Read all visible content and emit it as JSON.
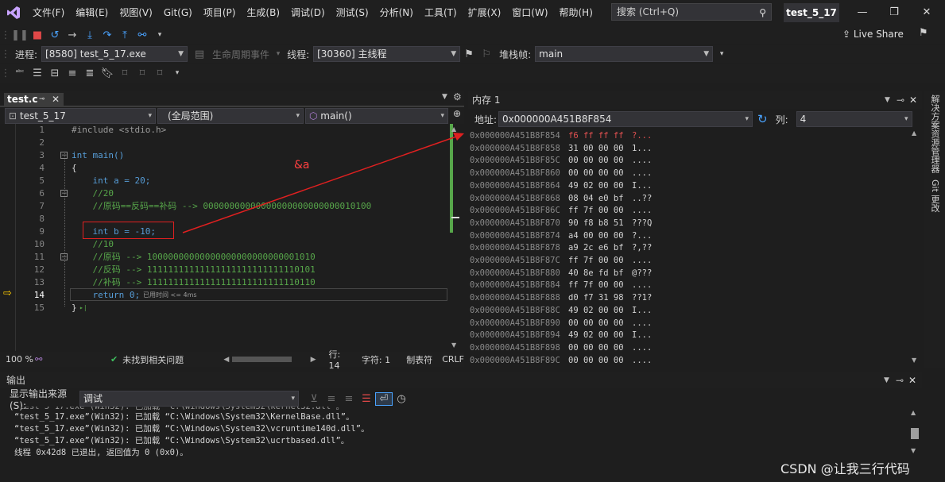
{
  "menu": [
    "文件(F)",
    "编辑(E)",
    "视图(V)",
    "Git(G)",
    "项目(P)",
    "生成(B)",
    "调试(D)",
    "测试(S)",
    "分析(N)",
    "工具(T)",
    "扩展(X)",
    "窗口(W)",
    "帮助(H)"
  ],
  "search": {
    "placeholder": "搜索 (Ctrl+Q)"
  },
  "window_title": "test_5_17",
  "live_share": "Live Share",
  "debug_bar": {
    "process_label": "进程:",
    "process_value": "[8580] test_5_17.exe",
    "lifecycle_label": "生命周期事件",
    "thread_label": "线程:",
    "thread_value": "[30360] 主线程",
    "stack_label": "堆栈帧:",
    "stack_value": "main"
  },
  "editor": {
    "tab_name": "test.c",
    "scope_project": "test_5_17",
    "scope_global": "(全局范围)",
    "scope_function": "main()",
    "lines": [
      {
        "n": "1",
        "t": "#include <stdio.h>"
      },
      {
        "n": "2",
        "t": ""
      },
      {
        "n": "3",
        "t": "int main()"
      },
      {
        "n": "4",
        "t": "{"
      },
      {
        "n": "5",
        "t": "    int a = 20;"
      },
      {
        "n": "6",
        "t": "    //20"
      },
      {
        "n": "7",
        "t": "    //原码==反码==补码 --> 00000000000000000000000000010100"
      },
      {
        "n": "8",
        "t": ""
      },
      {
        "n": "9",
        "t": "    int b = -10;"
      },
      {
        "n": "10",
        "t": "    //10"
      },
      {
        "n": "11",
        "t": "    //原码 --> 10000000000000000000000000001010"
      },
      {
        "n": "12",
        "t": "    //反码 --> 11111111111111111111111111110101"
      },
      {
        "n": "13",
        "t": "    //补码 --> 11111111111111111111111111110110"
      },
      {
        "n": "14",
        "t": "    return 0;"
      },
      {
        "n": "15",
        "t": "}"
      }
    ],
    "elapsed": "已用时间 <= 4ms",
    "annotation": "&a"
  },
  "editor_status": {
    "zoom": "100 %",
    "issues": "未找到相关问题",
    "line": "行: 14",
    "char": "字符: 1",
    "tabs": "制表符",
    "eol": "CRLF"
  },
  "memory": {
    "title": "内存 1",
    "addr_label": "地址:",
    "addr_value": "0x000000A451B8F854",
    "col_label": "列:",
    "col_value": "4",
    "rows": [
      {
        "a": "0x000000A451B8F854",
        "b": "f6 ff ff ff",
        "c": "?..."
      },
      {
        "a": "0x000000A451B8F858",
        "b": "31 00 00 00",
        "c": "1..."
      },
      {
        "a": "0x000000A451B8F85C",
        "b": "00 00 00 00",
        "c": "...."
      },
      {
        "a": "0x000000A451B8F860",
        "b": "00 00 00 00",
        "c": "...."
      },
      {
        "a": "0x000000A451B8F864",
        "b": "49 02 00 00",
        "c": "I..."
      },
      {
        "a": "0x000000A451B8F868",
        "b": "08 04 e0 bf",
        "c": "..??"
      },
      {
        "a": "0x000000A451B8F86C",
        "b": "ff 7f 00 00",
        "c": "...."
      },
      {
        "a": "0x000000A451B8F870",
        "b": "90 f8 b8 51",
        "c": "???Q"
      },
      {
        "a": "0x000000A451B8F874",
        "b": "a4 00 00 00",
        "c": "?..."
      },
      {
        "a": "0x000000A451B8F878",
        "b": "a9 2c e6 bf",
        "c": "?,??"
      },
      {
        "a": "0x000000A451B8F87C",
        "b": "ff 7f 00 00",
        "c": "...."
      },
      {
        "a": "0x000000A451B8F880",
        "b": "40 8e fd bf",
        "c": "@???"
      },
      {
        "a": "0x000000A451B8F884",
        "b": "ff 7f 00 00",
        "c": "...."
      },
      {
        "a": "0x000000A451B8F888",
        "b": "d0 f7 31 98",
        "c": "??1?"
      },
      {
        "a": "0x000000A451B8F88C",
        "b": "49 02 00 00",
        "c": "I..."
      },
      {
        "a": "0x000000A451B8F890",
        "b": "00 00 00 00",
        "c": "...."
      },
      {
        "a": "0x000000A451B8F894",
        "b": "49 02 00 00",
        "c": "I..."
      },
      {
        "a": "0x000000A451B8F898",
        "b": "00 00 00 00",
        "c": "...."
      },
      {
        "a": "0x000000A451B8F89C",
        "b": "00 00 00 00",
        "c": "...."
      }
    ]
  },
  "side_tabs": [
    "解决方案资源管理器",
    "Git 更改"
  ],
  "output": {
    "title": "输出",
    "source_label": "显示输出来源(S):",
    "source_value": "调试",
    "lines": [
      "“test_5_17.exe”(Win32): 已加载 “C:\\Windows\\System32\\KernelBase.dll”。",
      "“test_5_17.exe”(Win32): 已加载 “C:\\Windows\\System32\\vcruntime140d.dll”。",
      "“test_5_17.exe”(Win32): 已加载 “C:\\Windows\\System32\\ucrtbased.dll”。",
      "线程 0x42d8 已退出, 返回值为 0 (0x0)。"
    ]
  },
  "watermark": "CSDN @让我三行代码",
  "colors": {
    "accent": "#68217a",
    "highlight_box": "#e02020",
    "change_bar": "#57a64a"
  }
}
